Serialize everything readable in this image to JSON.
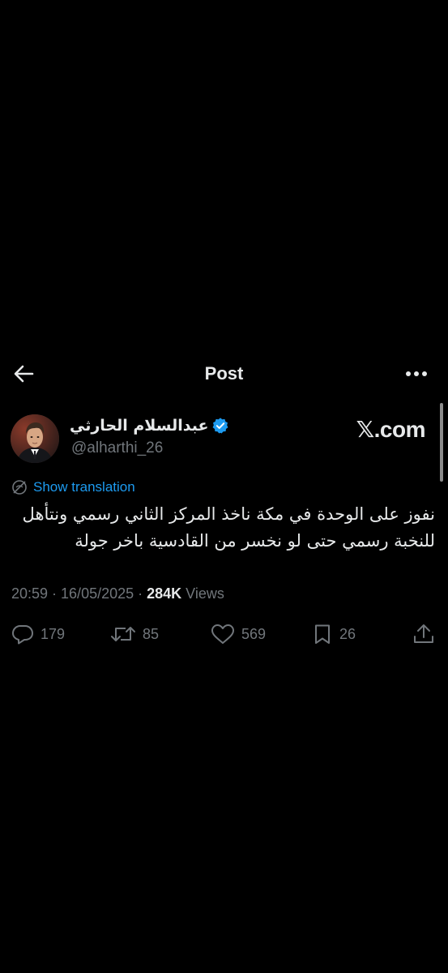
{
  "header": {
    "title": "Post",
    "back_icon": "arrow-left-icon",
    "more_icon": "more-horizontal-icon"
  },
  "author": {
    "name": "عبدالسلام الحارثي",
    "handle": "@alharthi_26",
    "verified": true,
    "verified_color": "#1d9bf0"
  },
  "brand": {
    "label": "𝕏.com"
  },
  "translation": {
    "label": "Show translation",
    "icon": "globe-icon",
    "color": "#1d9bf0"
  },
  "post": {
    "text": "نفوز على الوحدة في مكة ناخذ المركز الثاني رسمي ونتأهل للنخبة رسمي حتى لو نخسر من القادسية باخر جولة",
    "timestamp": "20:59 · 16/05/2025 · ",
    "views_count": "284K",
    "views_label": " Views"
  },
  "actions": {
    "replies": "179",
    "reposts": "85",
    "likes": "569",
    "bookmarks": "26"
  },
  "colors": {
    "background": "#000000",
    "text_primary": "#e7e9ea",
    "text_secondary": "#71767b",
    "accent": "#1d9bf0"
  }
}
